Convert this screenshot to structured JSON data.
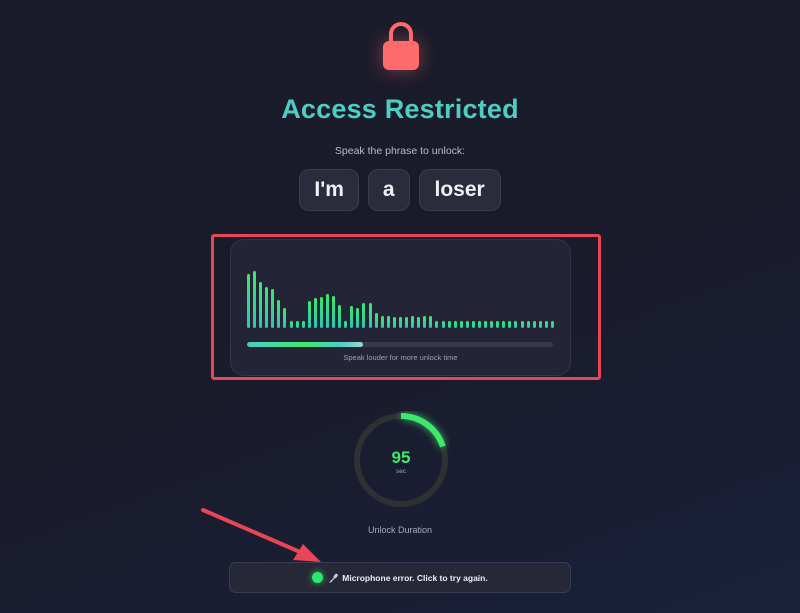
{
  "page": {
    "title": "Access Restricted",
    "subtitle": "Speak the phrase to unlock:",
    "phrase_words": [
      "I'm",
      "a",
      "loser"
    ]
  },
  "audio_meter": {
    "levels": [
      0.93,
      0.98,
      0.8,
      0.7,
      0.67,
      0.48,
      0.35,
      0.12,
      0.12,
      0.12,
      0.47,
      0.51,
      0.53,
      0.58,
      0.56,
      0.4,
      0.12,
      0.38,
      0.35,
      0.43,
      0.43,
      0.25,
      0.2,
      0.21,
      0.19,
      0.19,
      0.19,
      0.21,
      0.19,
      0.21,
      0.21,
      0.12,
      0.12,
      0.12,
      0.12,
      0.12,
      0.12,
      0.12,
      0.12,
      0.12,
      0.12,
      0.12,
      0.12,
      0.12,
      0.12,
      0.12,
      0.12,
      0.12,
      0.12,
      0.12,
      0.12
    ],
    "progress_fraction": 0.38,
    "hint": "Speak louder for more unlock time",
    "colors": {
      "bar_bottom": "#2ec4b6",
      "bar_top": "#3ee86d",
      "highlight": "#e84555"
    }
  },
  "timer": {
    "value": "95",
    "unit": "sec",
    "caption": "Unlock Duration",
    "arc_fraction": 0.2,
    "color": "#3ee86d"
  },
  "status": {
    "message": "Microphone error. Click to try again.",
    "icon": "microphone-icon",
    "indicator_color": "#2ee86b"
  },
  "colors": {
    "accent": "#4ecdc4",
    "lock": "#ff6b6b",
    "annotation": "#e84555"
  }
}
